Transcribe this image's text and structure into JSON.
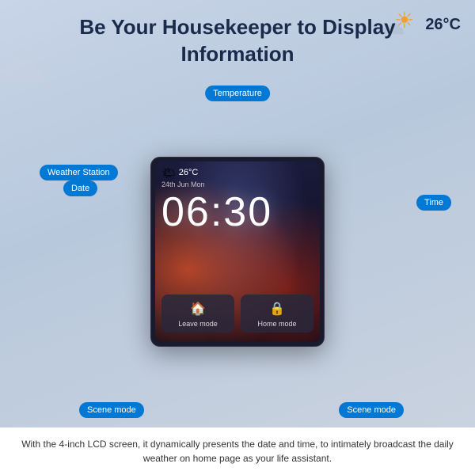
{
  "header": {
    "title": "Be Your Housekeeper to Display Information"
  },
  "weather_deco": {
    "temp": "26°C"
  },
  "screen": {
    "weather_temp": "26°C",
    "weather_date": "24th Jun Mon",
    "time": "06:30",
    "mode1_label": "Leave mode",
    "mode2_label": "Home mode"
  },
  "labels": {
    "temperature": "Temperature",
    "weather_station": "Weather Station",
    "date": "Date",
    "time": "Time",
    "scene_mode_1": "Scene mode",
    "scene_mode_2": "Scene mode"
  },
  "footer": {
    "text": "With the 4-inch LCD screen, it dynamically presents the date and time, to intimately broadcast the daily weather on home page as your life assistant."
  }
}
